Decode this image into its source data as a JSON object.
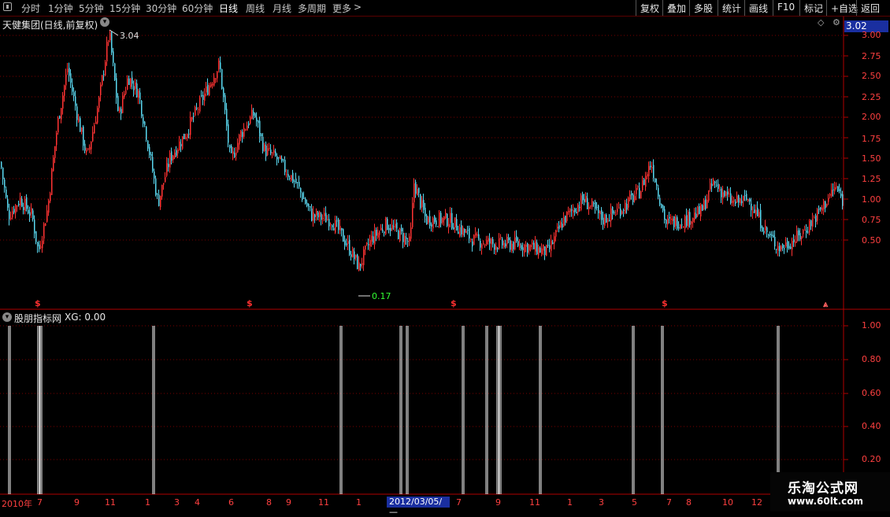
{
  "toolbar": {
    "periods": [
      "分时",
      "1分钟",
      "5分钟",
      "15分钟",
      "30分钟",
      "60分钟",
      "日线",
      "周线",
      "月线",
      "多周期",
      "更多"
    ],
    "active_period": "日线",
    "more_arrow": ">",
    "right_buttons": [
      "复权",
      "叠加",
      "多股",
      "统计",
      "画线",
      "F10",
      "标记",
      "+自选",
      "返回"
    ]
  },
  "main_chart": {
    "title": "天健集团(日线,前复权)",
    "current_price": "3.02",
    "high_label": "3.04",
    "low_label": "0.17",
    "y_ticks": [
      "3.00",
      "2.75",
      "2.50",
      "2.25",
      "2.00",
      "1.75",
      "1.50",
      "1.25",
      "1.00",
      "0.75",
      "0.50"
    ],
    "event_markers": [
      "$",
      "$",
      "$",
      "$",
      "⩓"
    ]
  },
  "indicator": {
    "title": "股朋指标网",
    "value_label": "XG: 0.00",
    "y_ticks": [
      "1.00",
      "0.80",
      "0.60",
      "0.40",
      "0.20"
    ]
  },
  "x_axis": {
    "labels": [
      "2010年",
      "7",
      "9",
      "11",
      "1",
      "3",
      "4",
      "6",
      "8",
      "9",
      "11",
      "1",
      "7",
      "9",
      "11",
      "1",
      "3",
      "5",
      "7",
      "8",
      "10",
      "12"
    ],
    "highlight_date": "2012/03/05/—"
  },
  "watermark": {
    "line1": "乐淘公式网",
    "line2": "www.60lt.com"
  },
  "colors": {
    "up": "#ff3333",
    "down": "#5ad8f0",
    "grid": "#7a0000",
    "axis": "#b00000",
    "accent": "#1a2fa0"
  }
}
